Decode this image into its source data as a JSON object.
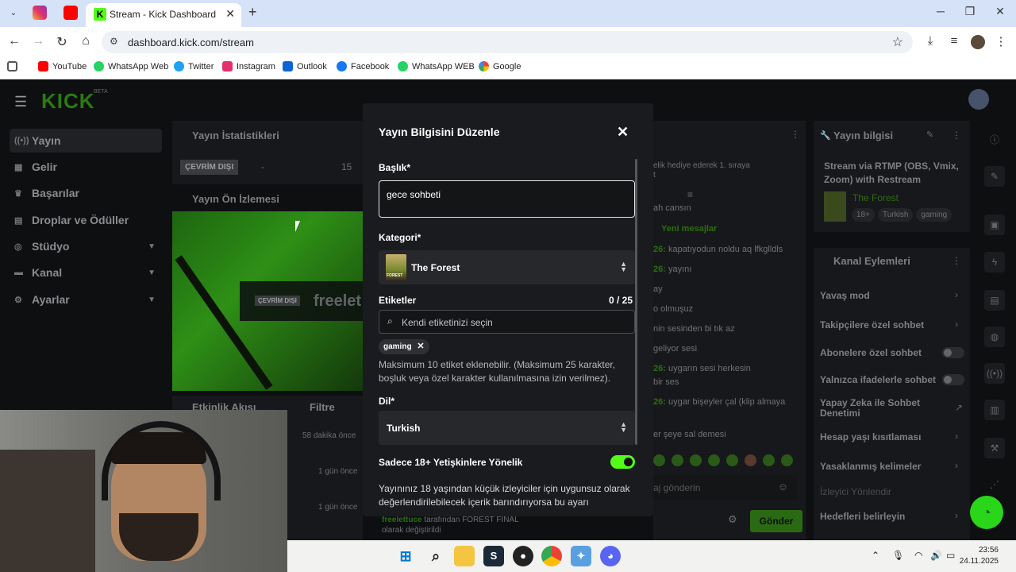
{
  "browser": {
    "tab_title": "Stream - Kick Dashboard",
    "tab_favicon": "K",
    "url": "dashboard.kick.com/stream",
    "bookmarks": [
      "YouTube",
      "WhatsApp Web",
      "Twitter",
      "Instagram",
      "Outlook",
      "Facebook",
      "WhatsApp WEB",
      "Google"
    ]
  },
  "sidebar": {
    "items": [
      "Yayın",
      "Gelir",
      "Başarılar",
      "Droplar ve Ödüller",
      "Stüdyo",
      "Kanal",
      "Ayarlar"
    ]
  },
  "stats": {
    "title": "Yayın İstatistikleri",
    "status": "ÇEVRİM DIŞI",
    "dash": "-",
    "count": "15"
  },
  "preview": {
    "title": "Yayın Ön İzlemesi",
    "badge": "ÇEVRİM DIŞI",
    "channel": "freelet"
  },
  "activity": {
    "title": "Etkinlik Akışı",
    "filter": "Filtre",
    "times": [
      "58 dakika önce",
      "1 gün önce",
      "1 gün önce"
    ],
    "footer_user": "freelettuce",
    "footer_text": " tarafından FOREST FINAL",
    "footer_text2": "olarak değiştirildi"
  },
  "chat": {
    "top_note": "elik hediye ederek 1. sıraya",
    "top_note2": "t",
    "new_messages": "Yeni mesajlar",
    "lines": [
      {
        "prefix": "",
        "text": "ah cansın"
      },
      {
        "prefix": "26:",
        "text": " kapatıyodun noldu aq lfkglldls"
      },
      {
        "prefix": "26:",
        "text": " yayını"
      },
      {
        "prefix": "",
        "text": "ay"
      },
      {
        "prefix": "",
        "text": "o olmuşuz"
      },
      {
        "prefix": "",
        "text": "nin sesinden bi tık az"
      },
      {
        "prefix": "",
        "text": " geliyor sesi"
      },
      {
        "prefix": "26:",
        "text": " uygarın sesi herkesin"
      },
      {
        "prefix": "",
        "text": "bir ses"
      },
      {
        "prefix": "26:",
        "text": " uygar bişeyler çal (klip almaya"
      },
      {
        "prefix": "",
        "text": "er şeye sal demesi"
      }
    ],
    "input_placeholder": "aj gönderin",
    "send": "Gönder"
  },
  "stream_info": {
    "title": "Yayın bilgisi",
    "name": "Stream via RTMP (OBS, Vmix, Zoom) with Restream",
    "category": "The Forest",
    "tags": [
      "18+",
      "Turkish",
      "gaming"
    ]
  },
  "channel_actions": {
    "title": "Kanal Eylemleri",
    "items": [
      {
        "label": "Yavaş mod",
        "kind": "chevron"
      },
      {
        "label": "Takipçilere özel sohbet",
        "kind": "chevron"
      },
      {
        "label": "Abonelere özel sohbet",
        "kind": "toggle"
      },
      {
        "label": "Yalnızca ifadelerle sohbet",
        "kind": "toggle"
      },
      {
        "label": "Yapay Zeka ile Sohbet Denetimi",
        "kind": "external"
      },
      {
        "label": "Hesap yaşı kısıtlaması",
        "kind": "chevron"
      },
      {
        "label": "Yasaklanmış kelimeler",
        "kind": "chevron"
      },
      {
        "label": "İzleyici Yönlendir",
        "kind": "none"
      },
      {
        "label": "Hedefleri belirleyin",
        "kind": "chevron"
      }
    ]
  },
  "modal": {
    "title": "Yayın Bilgisini Düzenle",
    "title_label": "Başlık*",
    "title_value": "gece sohbeti",
    "category_label": "Kategori*",
    "category_value": "The Forest",
    "category_thumb": "FOREST",
    "tags_label": "Etiketler",
    "tags_count": "0 / 25",
    "tags_placeholder": "Kendi etiketinizi seçin",
    "tag_chip": "gaming",
    "tags_help": "Maksimum 10 etiket eklenebilir. (Maksimum 25 karakter, boşluk veya özel karakter kullanılmasına izin verilmez).",
    "language_label": "Dil*",
    "language_value": "Turkish",
    "adult_label": "Sadece 18+ Yetişkinlere Yönelik",
    "adult_enabled": true,
    "adult_desc": "Yayınınız 18 yaşından küçük izleyiciler için uygunsuz olarak değerlendirilebilecek içerik barındırıyorsa bu ayarı"
  },
  "taskbar": {
    "time": "23:56",
    "date": "24.11.2025"
  }
}
